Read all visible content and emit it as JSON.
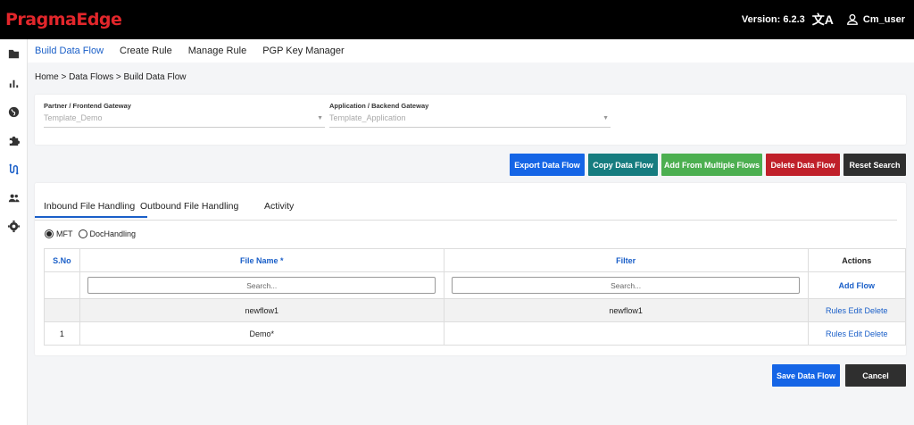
{
  "header": {
    "logo": "PragmaEdge",
    "version": "Version: 6.2.3",
    "translate_glyph": "文A",
    "user": "Cm_user",
    "bg": "#000000",
    "logo_color": "#e2262b"
  },
  "sidebar": {
    "icons": [
      "folder-icon",
      "bar-chart-icon",
      "globe-icon",
      "puzzle-icon",
      "data-flow-icon",
      "users-icon",
      "gear-icon"
    ]
  },
  "top_tabs": [
    "Build Data Flow",
    "Create Rule",
    "Manage Rule",
    "PGP Key Manager"
  ],
  "breadcrumb": "Home > Data Flows > Build Data Flow",
  "partner": {
    "label": "Partner / Frontend Gateway",
    "value": "Template_Demo"
  },
  "application": {
    "label": "Application / Backend Gateway",
    "value": "Template_Application"
  },
  "actions": {
    "export": "Export Data Flow",
    "copy": "Copy Data Flow",
    "add_multi": "Add From Multiple Flows",
    "delete": "Delete Data Flow",
    "reset": "Reset Search"
  },
  "inner_tabs": [
    "Inbound File Handling",
    "Outbound File Handling",
    "Activity"
  ],
  "radios": {
    "mft": "MFT",
    "doc": "DocHandling",
    "selected": "MFT"
  },
  "table": {
    "headers": {
      "sno": "S.No",
      "file": "File Name *",
      "filter": "Filter",
      "actions": "Actions"
    },
    "search_placeholder": "Search...",
    "add_flow": "Add Flow",
    "rows": [
      {
        "sno": "",
        "file": "newflow1",
        "filter": "newflow1",
        "actions": "Rules Edit Delete"
      },
      {
        "sno": "1",
        "file": "Demo*",
        "filter": "",
        "actions": "Rules Edit Delete"
      }
    ]
  },
  "footer": {
    "save": "Save Data Flow",
    "cancel": "Cancel"
  },
  "colors": {
    "primary": "#1565e6",
    "teal": "#167c7f",
    "green": "#4caf50",
    "red": "#c0202a",
    "dark": "#2f2f2f",
    "link": "#1a5fc8"
  }
}
